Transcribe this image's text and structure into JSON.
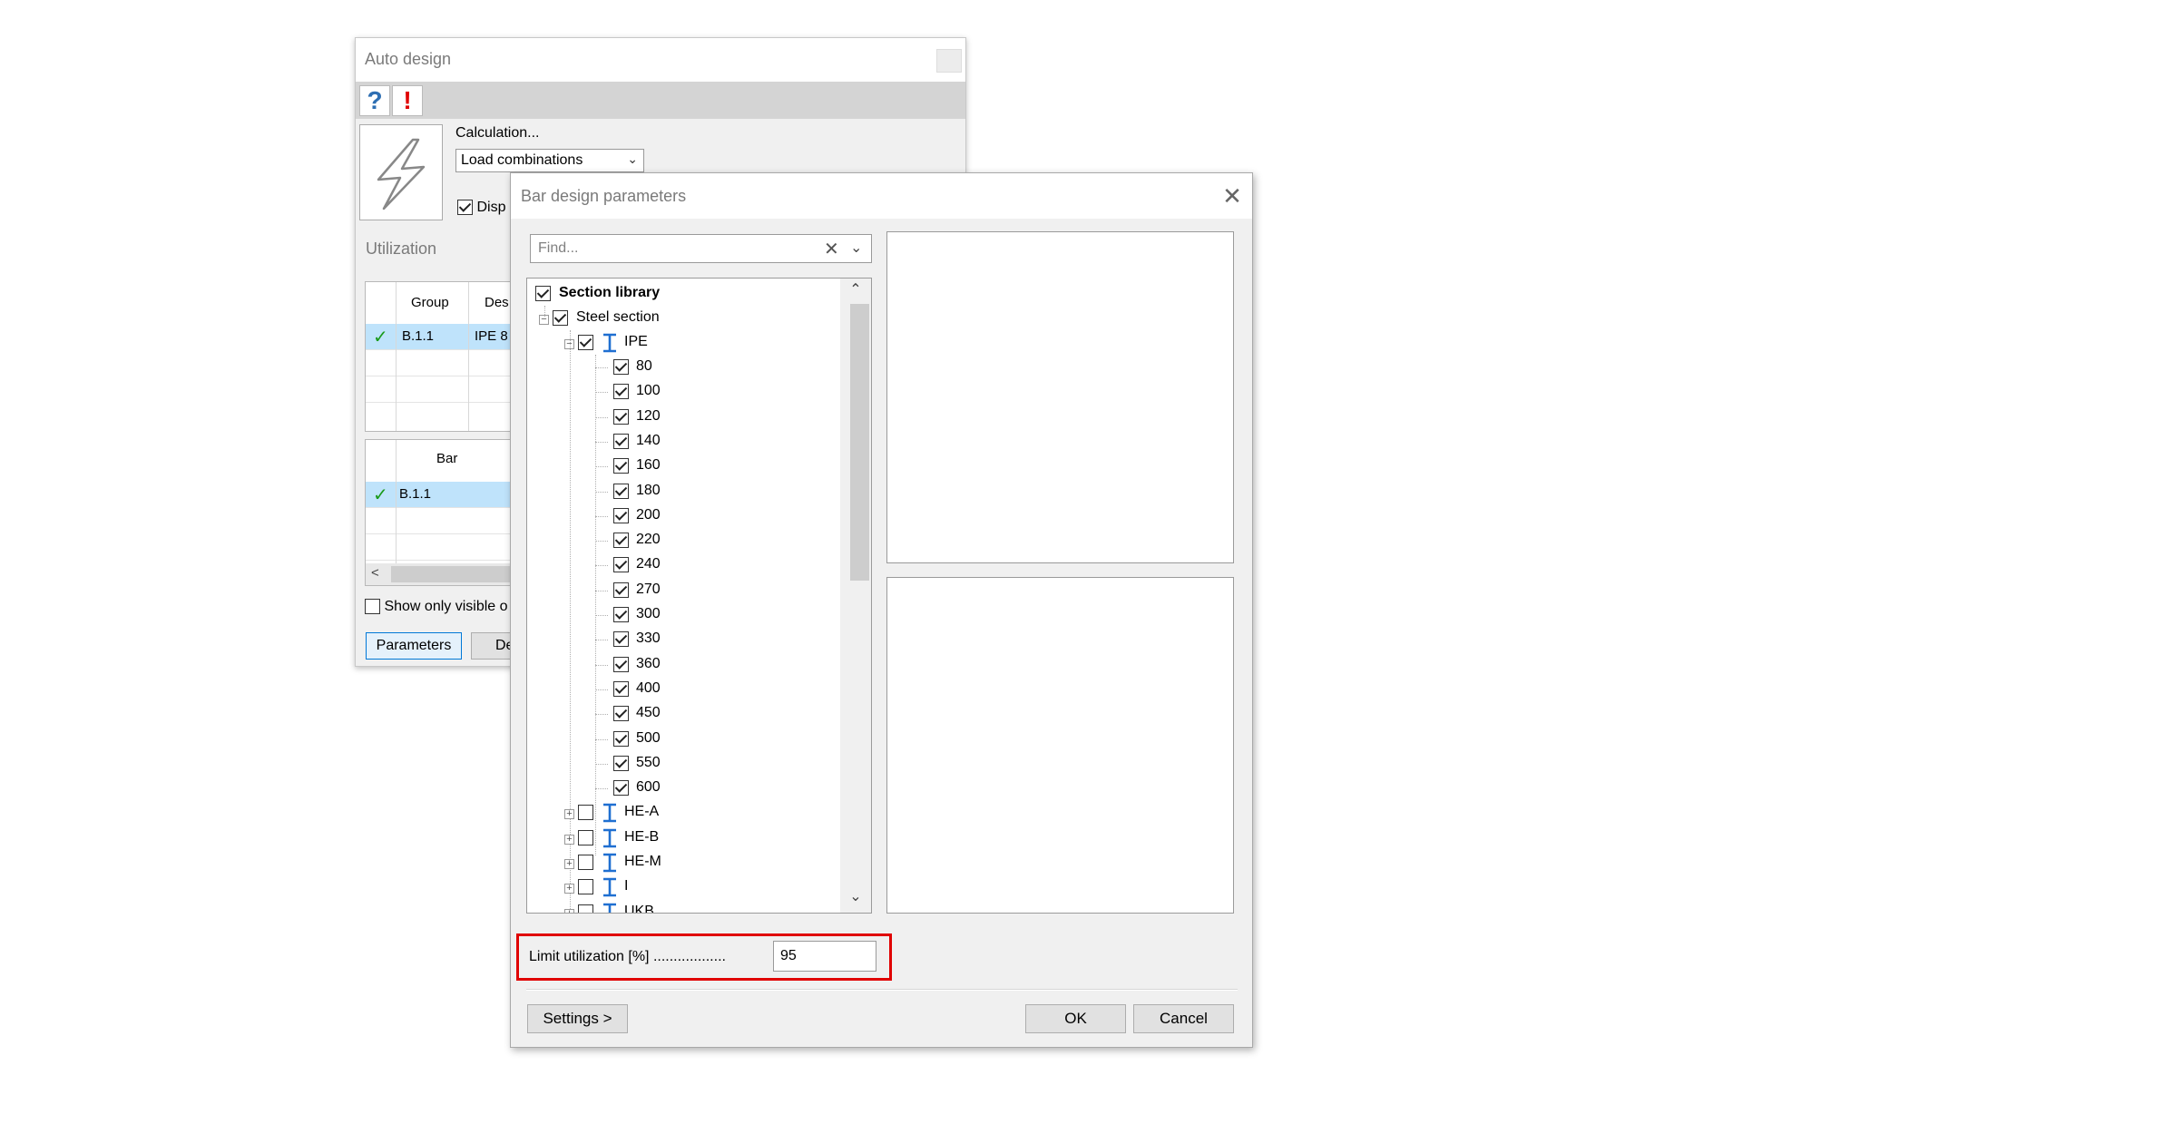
{
  "auto_design": {
    "title": "Auto design",
    "toolbar": {
      "help_glyph": "?",
      "warning_glyph": "!"
    },
    "calculation_label": "Calculation...",
    "calculation_value": "Load combinations",
    "display_label": "Disp",
    "utilization_label": "Utilization",
    "group_table": {
      "headers": [
        "Group",
        "Des"
      ],
      "rows": [
        {
          "status": "✓",
          "group": "B.1.1",
          "des": "IPE 8"
        }
      ]
    },
    "bar_table": {
      "headers": [
        "Bar"
      ],
      "rows": [
        {
          "status": "✓",
          "bar": "B.1.1"
        }
      ]
    },
    "show_only_visible_label": "Show only visible o",
    "parameters_label": "Parameters",
    "de_label": "De"
  },
  "bar_dialog": {
    "title": "Bar design parameters",
    "close_glyph": "✕",
    "find_placeholder": "Find...",
    "tree": {
      "root": {
        "label": "Section library",
        "checked": true
      },
      "steel": {
        "label": "Steel section",
        "checked": true
      },
      "ipe": {
        "label": "IPE",
        "checked": true
      },
      "ipe_sizes": [
        "80",
        "100",
        "120",
        "140",
        "160",
        "180",
        "200",
        "220",
        "240",
        "270",
        "300",
        "330",
        "360",
        "400",
        "450",
        "500",
        "550",
        "600"
      ],
      "other_families": [
        "HE-A",
        "HE-B",
        "HE-M",
        "I",
        "UKB"
      ]
    },
    "limit_label": "Limit utilization [%] ..................",
    "limit_value": "95",
    "buttons": {
      "settings": "Settings >",
      "ok": "OK",
      "cancel": "Cancel"
    }
  },
  "colors": {
    "highlight": "#e00000",
    "selection": "#bfe3fb",
    "accent_blue": "#0078d7",
    "check_green": "#1a9a1a"
  }
}
